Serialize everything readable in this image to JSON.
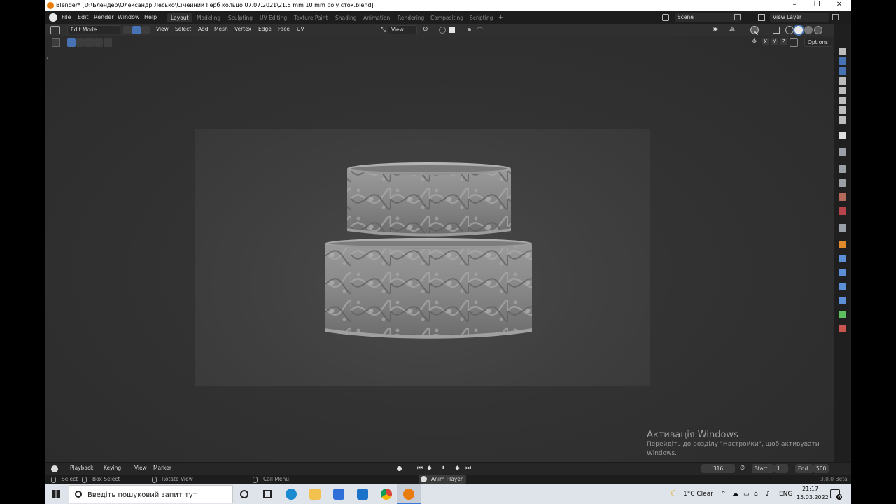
{
  "window": {
    "title": "Blender* [D:\\Блендер\\Олександр Лесько\\Сімейний Герб кольцо 07.07.2021\\21.5 mm 10 mm poly сток.blend]",
    "minimize_glyph": "–",
    "maximize_glyph": "❐",
    "close_glyph": "✕"
  },
  "menu": {
    "items": [
      "File",
      "Edit",
      "Render",
      "Window",
      "Help"
    ],
    "workspaces": [
      "Layout",
      "Modeling",
      "Sculpting",
      "UV Editing",
      "Texture Paint",
      "Shading",
      "Animation",
      "Rendering",
      "Compositing",
      "Scripting"
    ],
    "add_tab": "+",
    "scene": "Scene",
    "view_layer": "View Layer"
  },
  "viewport_header": {
    "mode": "Edit Mode",
    "menus": [
      "View",
      "Select",
      "Add",
      "Mesh",
      "Vertex",
      "Edge",
      "Face",
      "UV"
    ],
    "orientation": "View",
    "options": "Options",
    "axes": [
      "X",
      "Y",
      "Z"
    ]
  },
  "timeline": {
    "menus": [
      "Playback",
      "Keying",
      "View",
      "Marker"
    ],
    "current_frame": "316",
    "start_label": "Start",
    "start_value": "1",
    "end_label": "End",
    "end_value": "500"
  },
  "statusbar": {
    "select": "Select",
    "box_select": "Box Select",
    "rotate_view": "Rotate View",
    "call_menu": "Call Menu",
    "anim_player": "Anim Player",
    "version": "3.0.0 Beta"
  },
  "watermark": {
    "heading": "Активація Windows",
    "line": "Перейдіть до розділу \"Настройки\", щоб активувати Windows."
  },
  "taskbar": {
    "search_placeholder": "Введіть пошуковий запит тут",
    "weather": "1°C  Clear",
    "language": "ENG",
    "time": "21:17",
    "date": "15.03.2022",
    "notification_count": "6"
  },
  "colors": {
    "accent": "#4772b3",
    "blender_orange": "#e87d0d",
    "viewport_bg": "#303030"
  }
}
